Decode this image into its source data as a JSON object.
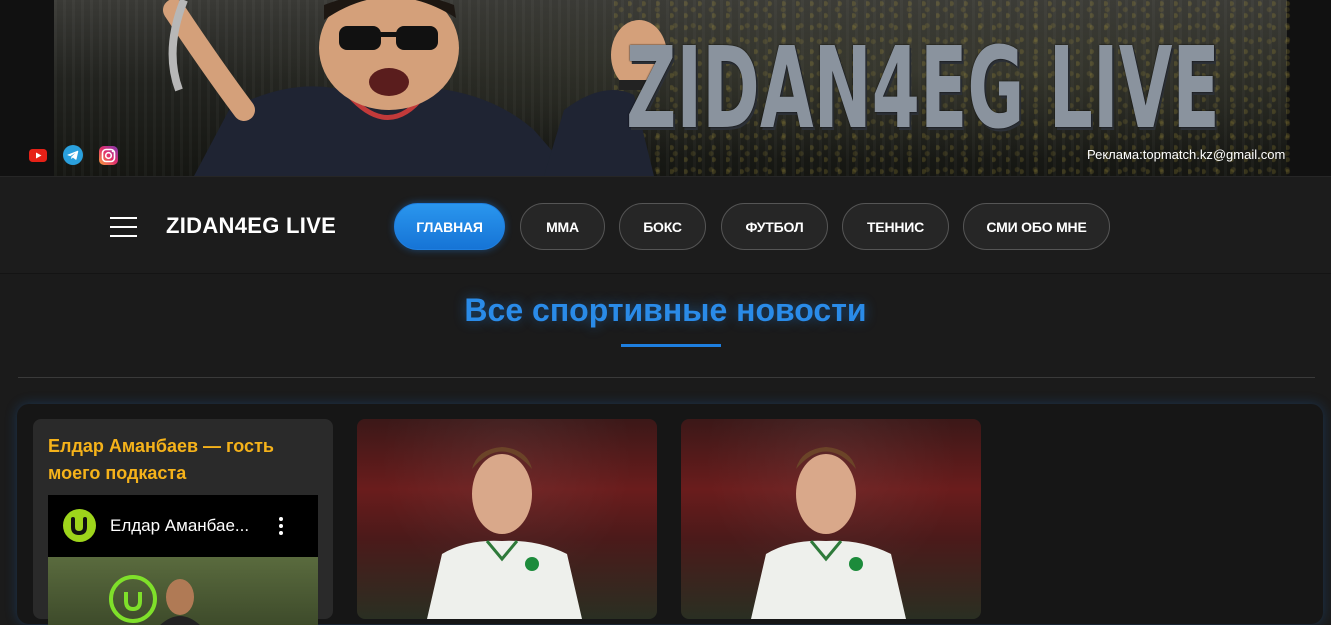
{
  "banner": {
    "logo_text": "ZIDAN4EG LIVE",
    "ad_text": "Реклама:topmatch.kz@gmail.com",
    "social_icons": [
      "youtube-icon",
      "telegram-icon",
      "instagram-icon"
    ]
  },
  "nav": {
    "site_title": "ZIDAN4EG LIVE",
    "items": [
      {
        "label": "ГЛАВНАЯ",
        "active": true
      },
      {
        "label": "MMA",
        "active": false
      },
      {
        "label": "БОКС",
        "active": false
      },
      {
        "label": "ФУТБОЛ",
        "active": false
      },
      {
        "label": "ТЕННИС",
        "active": false
      },
      {
        "label": "СМИ ОБО МНЕ",
        "active": false
      }
    ]
  },
  "section": {
    "title": "Все спортивные новости"
  },
  "podcast": {
    "title": "Елдар Аманбаев — гость моего подкаста",
    "video_title": "Елдар Аманбае..."
  },
  "colors": {
    "accent_blue": "#2a8be8",
    "podcast_title": "#f5b21a",
    "background": "#1b1b1b"
  }
}
